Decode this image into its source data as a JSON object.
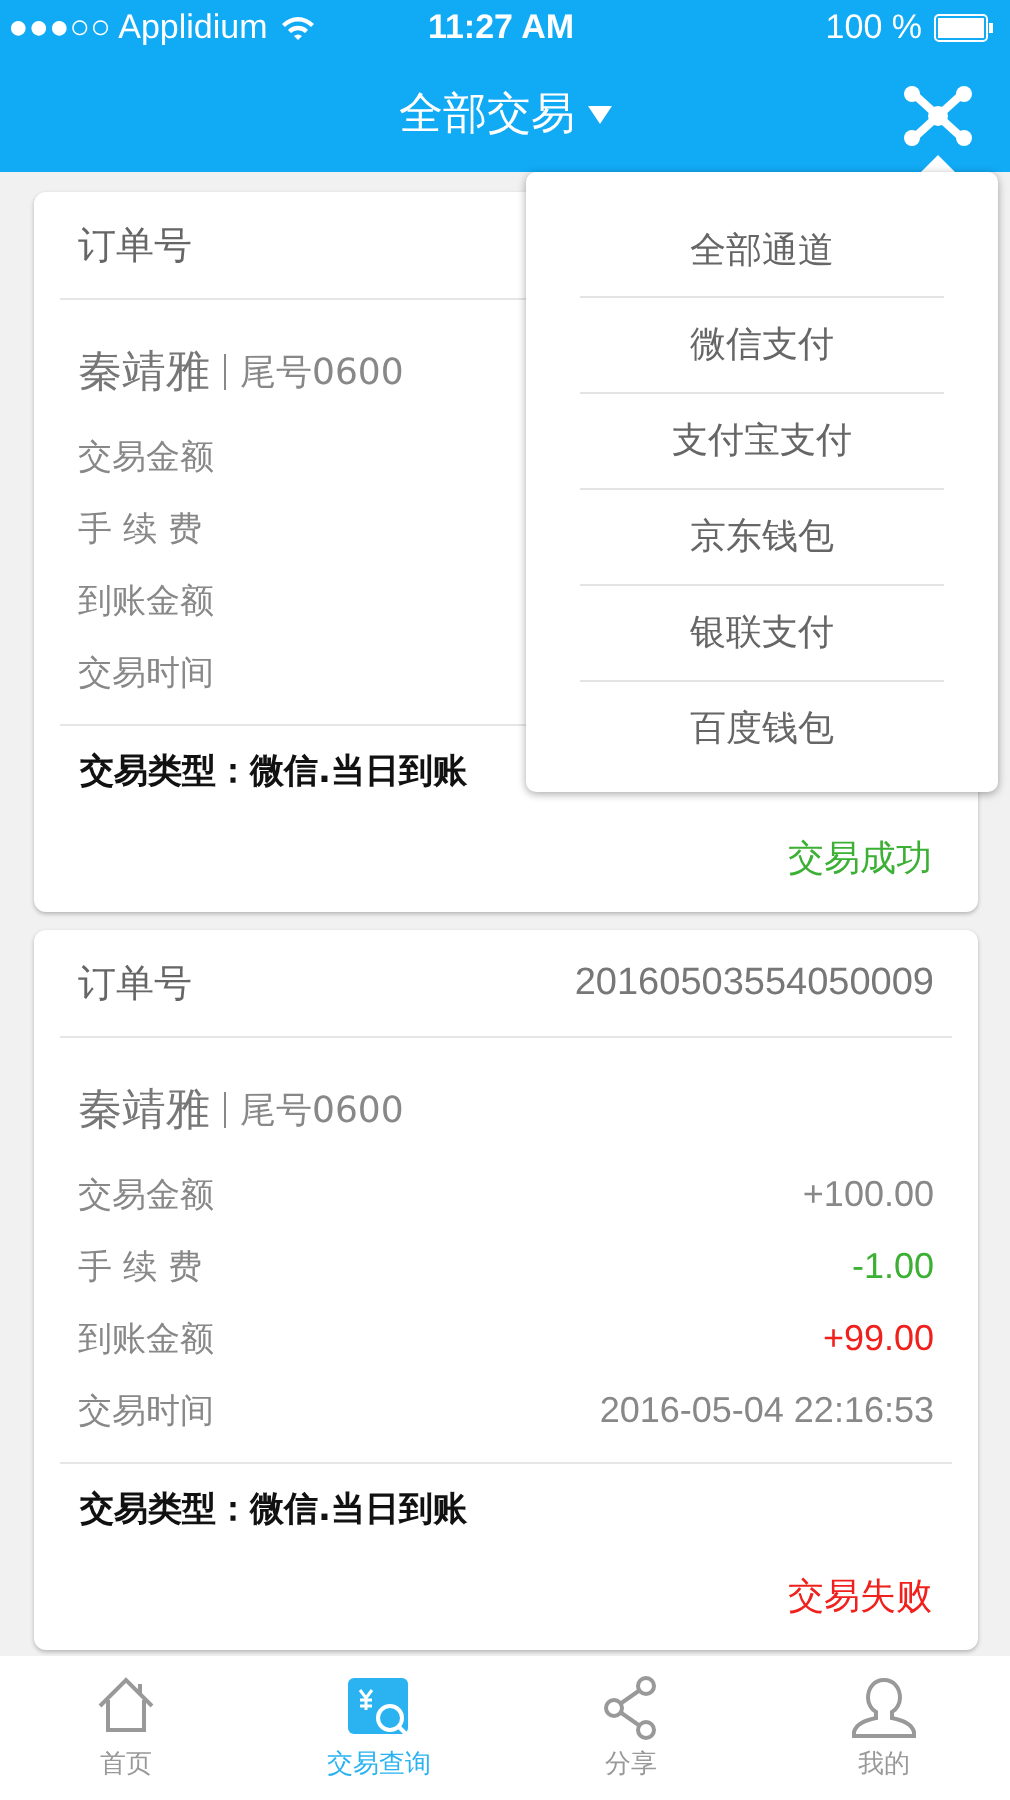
{
  "status_bar": {
    "carrier": "●●●○○ Applidium",
    "time": "11:27 AM",
    "battery": "100 %"
  },
  "nav_bar": {
    "title": "全部交易",
    "menu_open": true
  },
  "cards": [
    {
      "order_label": "订单号",
      "name": "秦靖雅",
      "tail": "尾号0600",
      "rows": [
        {
          "label": "交易金额"
        },
        {
          "label": "手 续 费"
        },
        {
          "label": "到账金额"
        },
        {
          "label": "交易时间"
        }
      ],
      "type": "交易类型：微信.当日到账",
      "status": "交易成功",
      "color": "#3cb034"
    },
    {
      "order_label": "订单号",
      "order_no": "20160503554050009",
      "name": "秦靖雅",
      "tail": "尾号0600",
      "rows": [
        {
          "label": "交易金额",
          "value": "+100.00",
          "kind": "neutral"
        },
        {
          "label": "手 续 费",
          "value": "-1.00",
          "kind": "positive"
        },
        {
          "label": "到账金额",
          "value": "+99.00",
          "kind": "negative"
        },
        {
          "label": "交易时间",
          "value": "2016-05-04 22:16:53",
          "kind": "neutral"
        }
      ],
      "type": "交易类型：微信.当日到账",
      "status": "交易失败",
      "color": "#f0201c"
    }
  ],
  "dropdown": {
    "items": [
      {
        "label": "全部通道"
      },
      {
        "label": "微信支付"
      },
      {
        "label": "支付宝支付"
      },
      {
        "label": "京东钱包"
      },
      {
        "label": "银联支付"
      },
      {
        "label": "百度钱包"
      }
    ]
  },
  "tab_bar": [
    {
      "label": "首页",
      "kind": "home",
      "selected": false
    },
    {
      "label": "交易查询",
      "kind": "query",
      "selected": true
    },
    {
      "label": "分享",
      "kind": "share",
      "selected": false
    },
    {
      "label": "我的",
      "kind": "user",
      "selected": false
    }
  ]
}
